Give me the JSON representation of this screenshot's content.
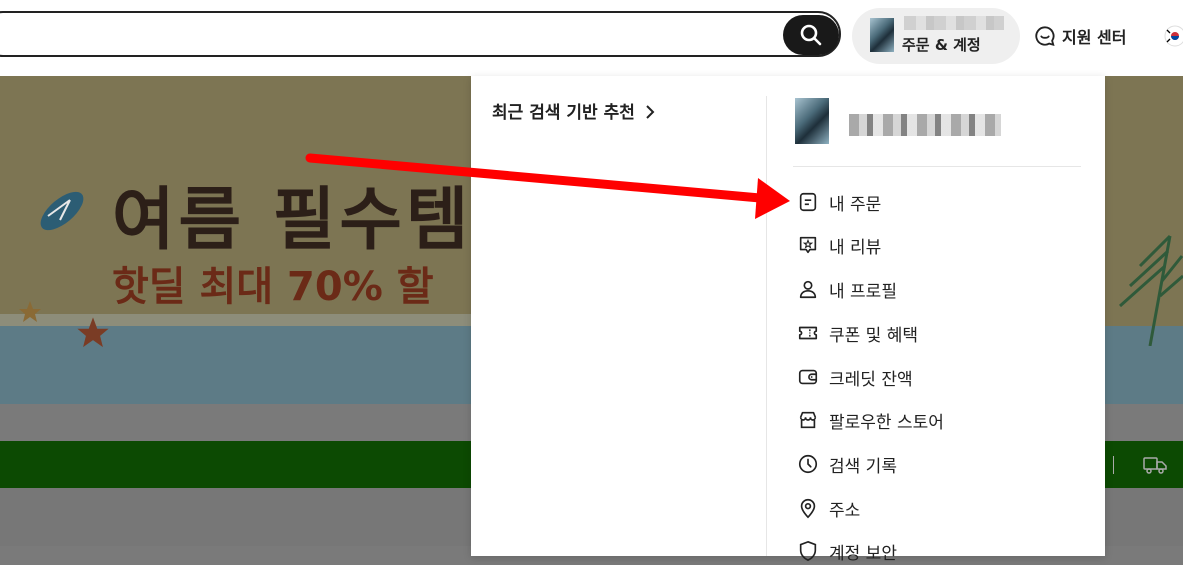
{
  "header": {
    "account_label": "주문 & 계정",
    "support_label": "지원 센터"
  },
  "banner": {
    "title": "여름 필수템",
    "subtitle": "핫딜 최대 70% 할"
  },
  "dropdown": {
    "recent_title": "최근 검색 기반 추천",
    "menu": [
      {
        "label": "내 주문",
        "icon": "order-icon"
      },
      {
        "label": "내 리뷰",
        "icon": "review-icon"
      },
      {
        "label": "내 프로필",
        "icon": "profile-icon"
      },
      {
        "label": "쿠폰 및 혜택",
        "icon": "coupon-icon"
      },
      {
        "label": "크레딧 잔액",
        "icon": "wallet-icon"
      },
      {
        "label": "팔로우한 스토어",
        "icon": "store-icon"
      },
      {
        "label": "검색 기록",
        "icon": "clock-icon"
      },
      {
        "label": "주소",
        "icon": "location-icon"
      },
      {
        "label": "계정 보안",
        "icon": "shield-icon"
      }
    ]
  },
  "colors": {
    "annotation_arrow": "#ff0000",
    "search_button": "#191919",
    "banner_stripe": "#0c4a02"
  }
}
